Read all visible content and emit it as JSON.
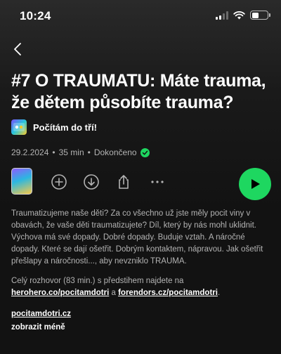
{
  "status_bar": {
    "time": "10:24",
    "icons": [
      "signal-icon",
      "wifi-icon",
      "battery-icon"
    ]
  },
  "nav": {
    "back_icon": "chevron-left-icon"
  },
  "episode": {
    "title": "#7 O TRAUMATU: Máte trauma, že dětem působíte trauma?",
    "show_name": "Počítám do tří!",
    "date": "29.2.2024",
    "separator": "•",
    "duration": "35 min",
    "status": "Dokončeno",
    "description": "Traumatizujeme naše děti? Za co všechno už jste měly pocit viny v obavách, že vaše děti traumatizujete? Díl, který by nás mohl uklidnit. Výchova má své dopady. Dobré dopady. Buduje vztah. A náročné dopady. Které se dají ošetřit. Dobrým kontaktem, nápravou. Jak ošetřit přešlapy a náročnosti..., aby nevzniklo TRAUMA.",
    "more_text_before": "Celý rozhovor (83 min.) s předstihem najdete na ",
    "link1": "herohero.co/pocitamdotri",
    "more_text_middle": " a ",
    "link2": "forendors.cz/pocitamdotri",
    "more_text_after": ".",
    "site_link": "pocitamdotri.cz",
    "show_less": "zobrazit méně"
  },
  "actions": {
    "add_icon": "plus-circle-icon",
    "download_icon": "download-circle-icon",
    "share_icon": "share-icon",
    "more_icon": "more-dots-icon",
    "play_icon": "play-icon"
  },
  "colors": {
    "accent": "#1ed760",
    "background": "#121212",
    "secondary_text": "#b3b3b3"
  }
}
